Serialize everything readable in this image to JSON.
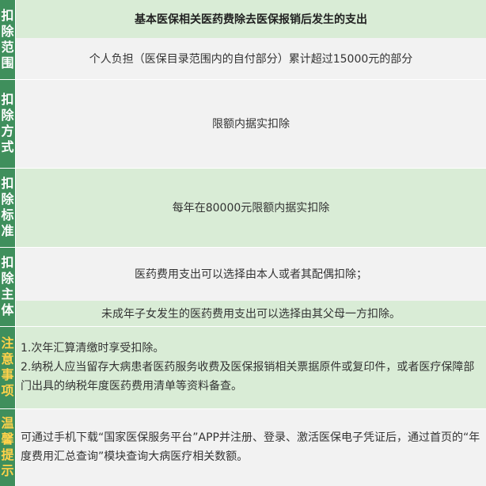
{
  "rows": [
    {
      "label": [
        "扣",
        "除",
        "范",
        "围"
      ],
      "lines": [
        "基本医保相关医药费除去医保报销后发生的支出",
        "个人负担（医保目录范围内的自付部分）累计超过15000元的部分"
      ]
    },
    {
      "label": [
        "扣",
        "除",
        "方",
        "式"
      ],
      "text": "限额内据实扣除"
    },
    {
      "label": [
        "扣",
        "除",
        "标",
        "准"
      ],
      "text": "每年在80000元限额内据实扣除"
    },
    {
      "label": [
        "扣",
        "除",
        "主",
        "体"
      ],
      "lines": [
        "医药费用支出可以选择由本人或者其配偶扣除；",
        "未成年子女发生的医药费用支出可以选择由其父母一方扣除。"
      ]
    },
    {
      "label": [
        "注",
        "意",
        "事",
        "项"
      ],
      "lines": [
        "1.次年汇算清缴时享受扣除。",
        "2.纳税人应当留存大病患者医药服务收费及医保报销相关票据原件或复印件，或者医疗保障部门出具的纳税年度医药费用清单等资料备查。"
      ]
    },
    {
      "label": [
        "温",
        "馨",
        "提",
        "示"
      ],
      "text": "可通过手机下载“国家医保服务平台”APP并注册、登录、激活医保电子凭证后，通过首页的“年度费用汇总查询”模块查询大病医疗相关数额。"
    }
  ],
  "colors": {
    "label_bg": "#3f8f5c",
    "label_text": "#ffffff",
    "notice_label_text": "#ffd24a",
    "row_green": "#d9ecd6",
    "row_grey": "#f2f2f2"
  }
}
